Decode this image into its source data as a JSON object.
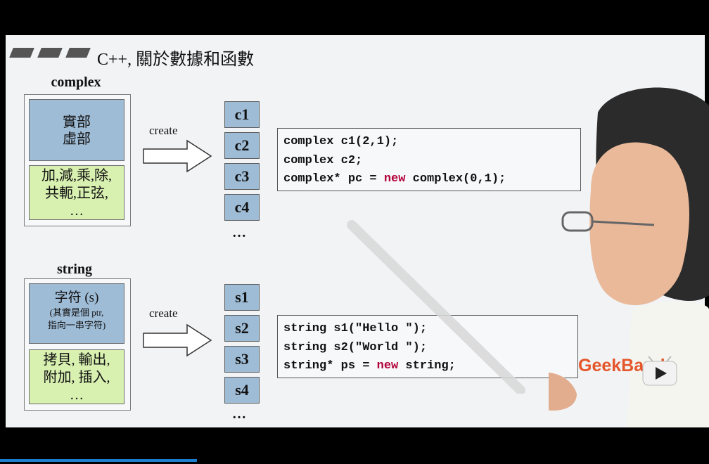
{
  "slide": {
    "title": "C++, 關於數據和函數",
    "complex": {
      "label": "complex",
      "data_lines": [
        "實部",
        "虛部"
      ],
      "func_lines": [
        "加,減,乘,除,",
        "共軛,正弦,",
        "…"
      ],
      "create_label": "create",
      "objects": [
        "c1",
        "c2",
        "c3",
        "c4"
      ],
      "more": "…",
      "code": {
        "line1": "complex c1(2,1);",
        "line2": "complex c2;",
        "line3_pre": "complex* pc = ",
        "line3_kw": "new",
        "line3_post": " complex(0,1);"
      }
    },
    "string": {
      "label": "string",
      "data_title": "字符 (s)",
      "data_note1": "(其實是個 ptr,",
      "data_note2": "指向一串字符)",
      "func_lines": [
        "拷貝, 輸出,",
        "附加, 插入,",
        "…"
      ],
      "create_label": "create",
      "objects": [
        "s1",
        "s2",
        "s3",
        "s4"
      ],
      "more": "…",
      "code": {
        "line1": "string s1(\"Hello \");",
        "line2": "string s2(\"World \");",
        "line3_pre": "string* ps = ",
        "line3_kw": "new",
        "line3_post": " string;"
      }
    }
  },
  "watermark": {
    "brand": "GeekBand",
    "icon": "play-icon"
  },
  "colors": {
    "data_box": "#9fbcd6",
    "func_box": "#d8f0b0",
    "keyword": "#b3003a",
    "brand": "#e5562b"
  }
}
